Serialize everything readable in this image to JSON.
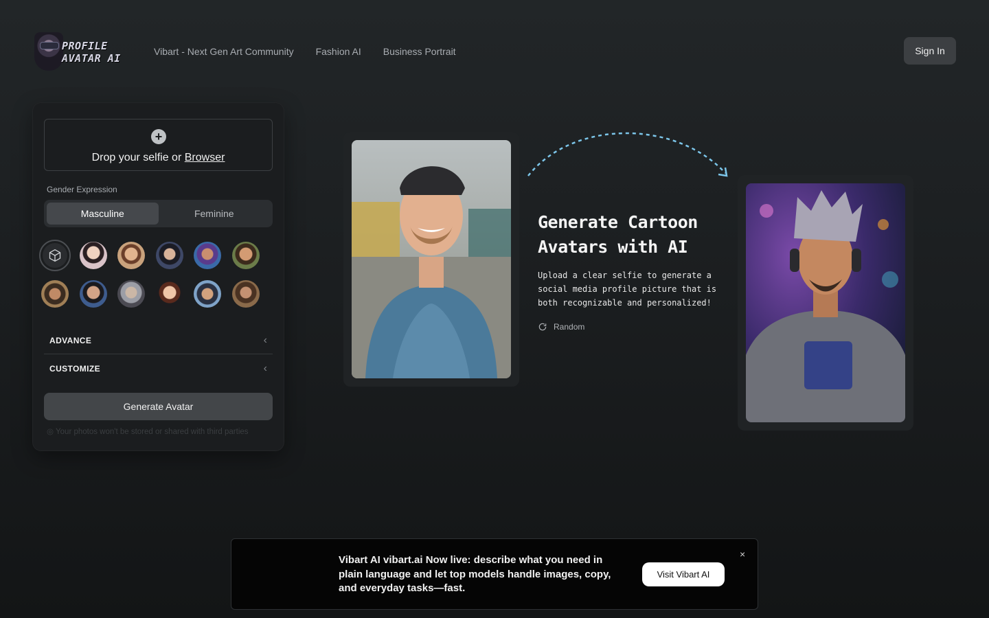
{
  "header": {
    "logo_line1": "PROFILE",
    "logo_line2": "AVATAR AI",
    "nav": [
      "Vibart - Next Gen Art Community",
      "Fashion AI",
      "Business Portrait"
    ],
    "sign_in": "Sign In"
  },
  "panel": {
    "dropzone": {
      "prefix": "Drop your selfie or ",
      "link": "Browser"
    },
    "gender_label": "Gender Expression",
    "gender_options": [
      "Masculine",
      "Feminine"
    ],
    "gender_selected": "Masculine",
    "style_icons": [
      "custom-style-icon"
    ],
    "accordions": [
      "ADVANCE",
      "CUSTOMIZE"
    ],
    "generate_label": "Generate Avatar",
    "privacy": "Your photos won't be stored or shared with third parties"
  },
  "hero": {
    "headline": "Generate Cartoon Avatars with AI",
    "subtext": "Upload a clear selfie to generate a social media profile picture that is both recognizable and personalized!",
    "random_label": "Random"
  },
  "banner": {
    "text": "Vibart AI vibart.ai Now live: describe what you need in plain language and let top models handle images, copy, and everyday tasks—fast.",
    "button": "Visit Vibart AI",
    "close": "×"
  },
  "colors": {
    "accent_arrow": "#7cc6ea",
    "background": "#1c1f21"
  }
}
